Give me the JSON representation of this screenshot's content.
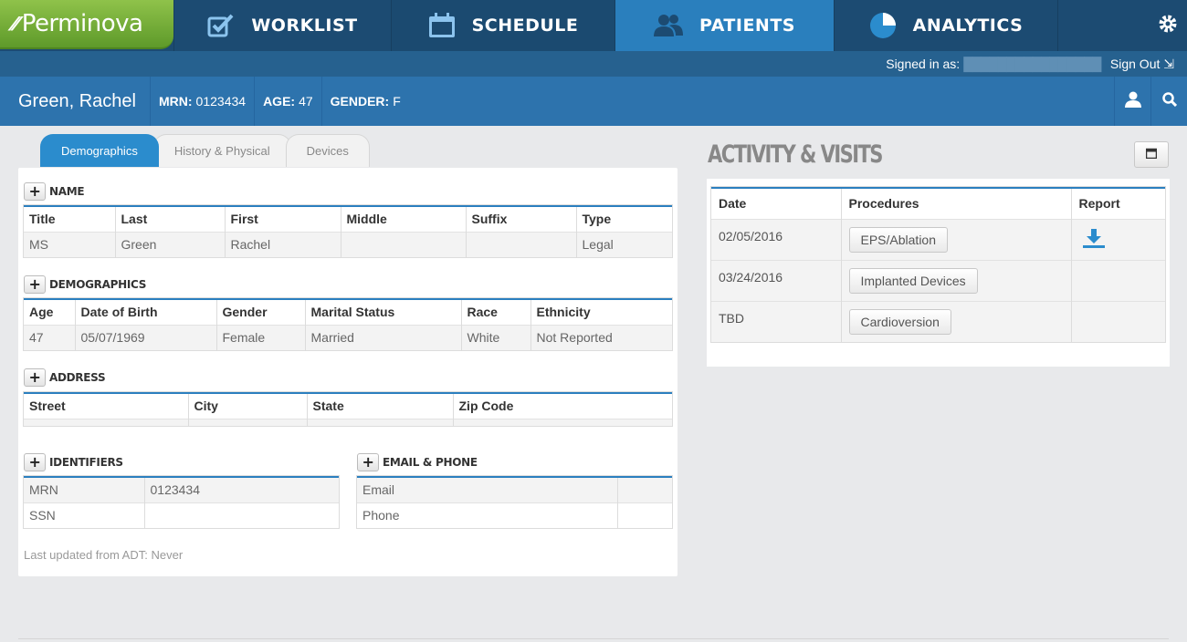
{
  "app": {
    "logo_text": "Perminova"
  },
  "nav": {
    "items": [
      {
        "label": "WORKLIST",
        "icon": "checkbox-icon"
      },
      {
        "label": "SCHEDULE",
        "icon": "calendar-icon"
      },
      {
        "label": "PATIENTS",
        "icon": "users-icon",
        "active": true
      },
      {
        "label": "ANALYTICS",
        "icon": "pie-chart-icon"
      }
    ],
    "settings_icon": "gear-icon"
  },
  "signin": {
    "label": "Signed in as:",
    "user": "████████████████",
    "signout": "Sign Out"
  },
  "patient": {
    "name": "Green, Rachel",
    "mrn_label": "MRN:",
    "mrn": "0123434",
    "age_label": "AGE:",
    "age": "47",
    "gender_label": "GENDER:",
    "gender": "F"
  },
  "tabs": [
    "Demographics",
    "History & Physical",
    "Devices"
  ],
  "name_section": {
    "title": "NAME",
    "headers": [
      "Title",
      "Last",
      "First",
      "Middle",
      "Suffix",
      "Type"
    ],
    "row": [
      "MS",
      "Green",
      "Rachel",
      "",
      "",
      "Legal"
    ]
  },
  "demographics_section": {
    "title": "DEMOGRAPHICS",
    "headers": [
      "Age",
      "Date of Birth",
      "Gender",
      "Marital Status",
      "Race",
      "Ethnicity"
    ],
    "row": [
      "47",
      "05/07/1969",
      "Female",
      "Married",
      "White",
      "Not Reported"
    ]
  },
  "address_section": {
    "title": "ADDRESS",
    "headers": [
      "Street",
      "City",
      "State",
      "Zip Code"
    ]
  },
  "identifiers_section": {
    "title": "IDENTIFIERS",
    "rows": [
      [
        "MRN",
        "0123434"
      ],
      [
        "SSN",
        ""
      ]
    ]
  },
  "contact_section": {
    "title": "EMAIL & PHONE",
    "rows": [
      [
        "Email",
        ""
      ],
      [
        "Phone",
        ""
      ]
    ]
  },
  "last_updated": "Last updated from ADT: Never",
  "activity": {
    "title": "ACTIVITY & VISITS",
    "headers": [
      "Date",
      "Procedures",
      "Report"
    ],
    "rows": [
      {
        "date": "02/05/2016",
        "procedure": "EPS/Ablation",
        "report": "download-icon"
      },
      {
        "date": "03/24/2016",
        "procedure": "Implanted Devices",
        "report": ""
      },
      {
        "date": "TBD",
        "procedure": "Cardioversion",
        "report": ""
      }
    ]
  },
  "colors": {
    "nav_bg": "#1c4b72",
    "active_tab": "#2a7fbd",
    "patient_bar": "#2d73ad",
    "logo_green": "#6fae34",
    "accent_blue": "#2b7fbf"
  }
}
